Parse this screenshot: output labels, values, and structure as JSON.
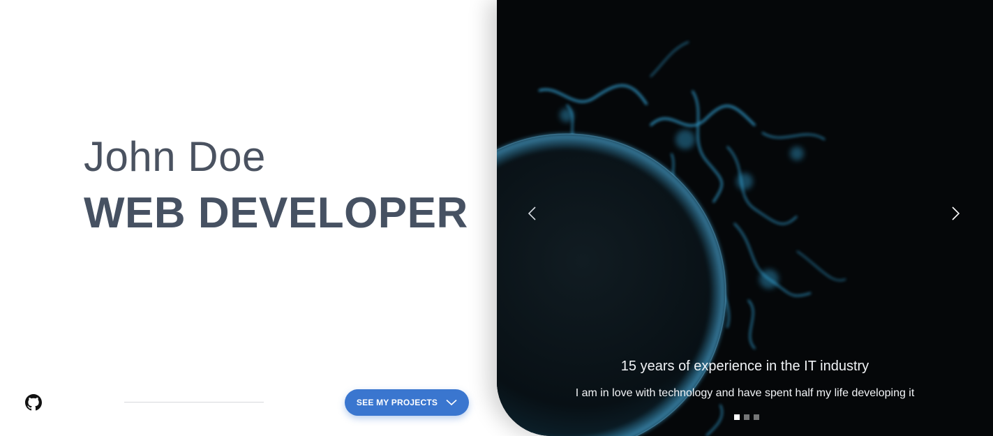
{
  "hero": {
    "name": "John Doe",
    "role": "WEB DEVELOPER",
    "cta_label": "SEE MY PROJECTS",
    "social_icon": "github-icon"
  },
  "carousel": {
    "slide_title": "15 years of experience in the IT industry",
    "slide_text": "I am in love with technology and have spent half my life developing it",
    "slides_total": 3,
    "active_slide": 1,
    "prev_icon": "chevron-left-icon",
    "next_icon": "chevron-right-icon"
  },
  "colors": {
    "text_dark": "#465162",
    "accent": "#3a76cf",
    "carousel_bg": "#050709",
    "glow": "#3ec3ff"
  }
}
